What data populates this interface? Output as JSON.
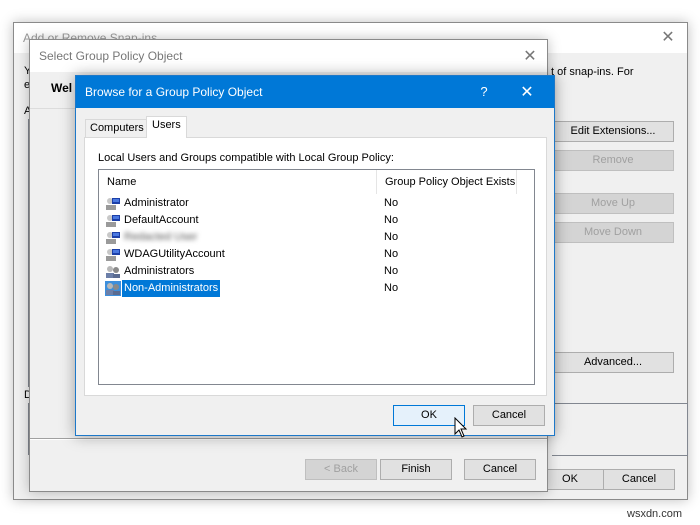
{
  "outer_window": {
    "title": "Add or Remove Snap-ins",
    "desc_fragment_left_1": "Y",
    "desc_fragment_left_2": "e",
    "desc_fragment_right": "t of snap-ins. For",
    "label_a": "A",
    "label_d": "D",
    "buttons": {
      "edit_extensions": "Edit Extensions...",
      "remove": "Remove",
      "move_up": "Move Up",
      "move_down": "Move Down",
      "advanced": "Advanced...",
      "ok": "OK",
      "cancel": "Cancel"
    }
  },
  "middle_window": {
    "title": "Select Group Policy Object",
    "welcome_fragment": "Wel",
    "buttons": {
      "back": "< Back",
      "finish": "Finish",
      "cancel": "Cancel"
    }
  },
  "browse_dialog": {
    "title": "Browse for a Group Policy Object",
    "help_glyph": "?",
    "close_glyph": "✕",
    "tabs": [
      {
        "label": "Computers",
        "active": false
      },
      {
        "label": "Users",
        "active": true
      }
    ],
    "list_label": "Local Users and Groups compatible with Local Group Policy:",
    "columns": [
      "Name",
      "Group Policy Object Exists"
    ],
    "rows": [
      {
        "name": "Administrator",
        "gpo_exists": "No",
        "icon": "user-icon",
        "selected": false,
        "blurred": false
      },
      {
        "name": "DefaultAccount",
        "gpo_exists": "No",
        "icon": "user-icon",
        "selected": false,
        "blurred": false
      },
      {
        "name": "Redacted User",
        "gpo_exists": "No",
        "icon": "user-icon",
        "selected": false,
        "blurred": true
      },
      {
        "name": "WDAGUtilityAccount",
        "gpo_exists": "No",
        "icon": "user-icon",
        "selected": false,
        "blurred": false
      },
      {
        "name": "Administrators",
        "gpo_exists": "No",
        "icon": "group-icon",
        "selected": false,
        "blurred": false
      },
      {
        "name": "Non-Administrators",
        "gpo_exists": "No",
        "icon": "group-icon",
        "selected": true,
        "blurred": false
      }
    ],
    "buttons": {
      "ok": "OK",
      "cancel": "Cancel"
    }
  },
  "close_glyph": "✕",
  "watermark": "wsxdn.com",
  "colors": {
    "accent": "#0078d7",
    "dialog_bg": "#f0f0f0",
    "button_bg": "#e1e1e1",
    "disabled_text": "#a0a0a0"
  }
}
